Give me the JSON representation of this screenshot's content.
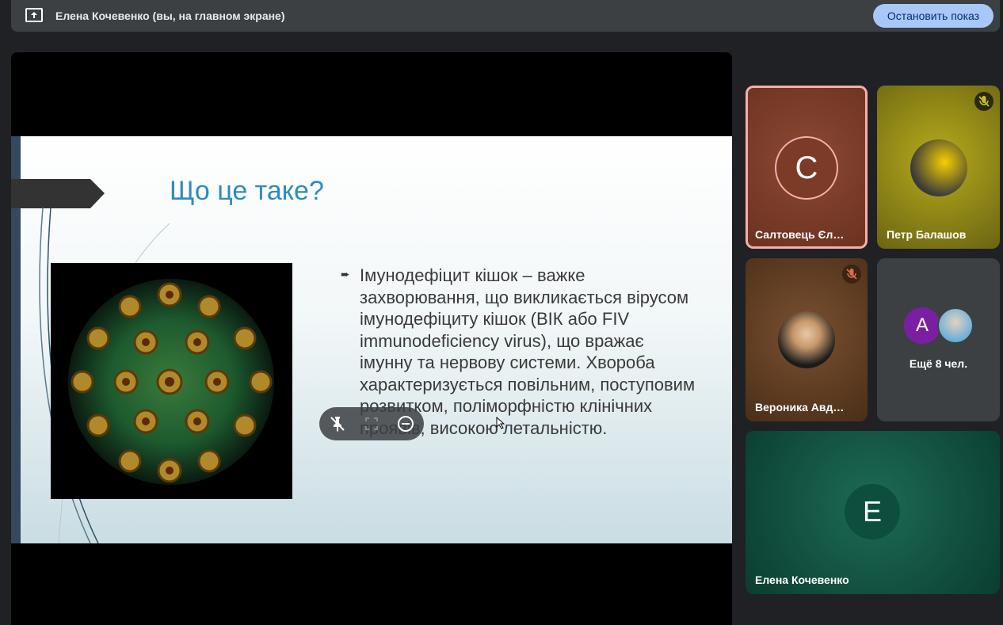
{
  "topbar": {
    "title": "Елена Кочевенко (вы, на главном экране)",
    "stop_button": "Остановить показ"
  },
  "slide": {
    "title": "Що це таке?",
    "bullet_symbol": "➨",
    "body": "Імунодефіцит кішок – важке захворювання, що викликається вірусом імунодефіциту кішок (ВІК або FIV immunodeficiency virus), що вражає імунну та нервову системи. Хвороба характеризується повільним, поступовим розвитком, поліморфністю клінічних проявів, високою летальністю."
  },
  "participants": [
    {
      "name": "Салтовець Єл…",
      "avatar_letter": "С",
      "muted": false,
      "active_speaker": true
    },
    {
      "name": "Петр Балашов",
      "muted": true
    },
    {
      "name": "Вероника Авд…",
      "muted": true
    },
    {
      "more_label": "Ещё 8 чел.",
      "avatar_letter": "А"
    },
    {
      "name": "Елена Кочевенко",
      "avatar_letter": "Е"
    }
  ],
  "colors": {
    "accent": "#a8c7fa",
    "active_border": "#f6aea9",
    "tile1": "#7b3b27",
    "tile2": "#8c8512",
    "tile3": "#5a3a1e",
    "tile4": "#3c4043",
    "tile5": "#0d4f3e"
  }
}
